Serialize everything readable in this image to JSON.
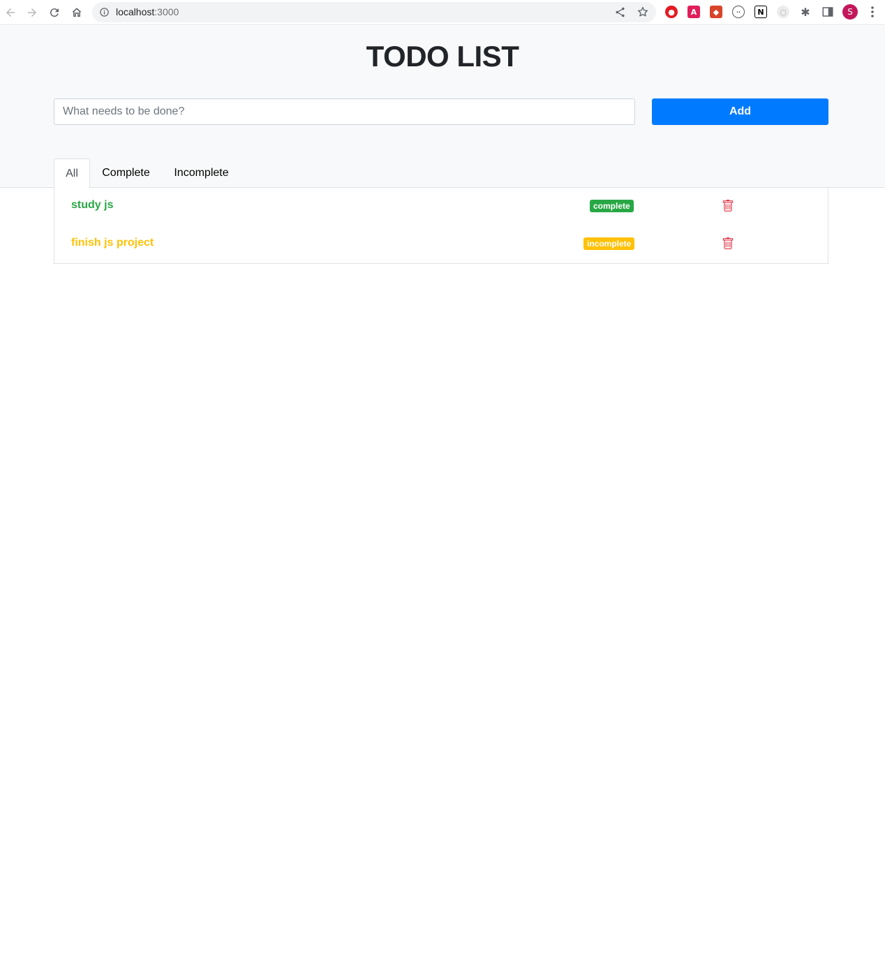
{
  "browser": {
    "url_host": "localhost",
    "url_port": ":3000",
    "avatar_letter": "S"
  },
  "app": {
    "title": "TODO LIST",
    "input_placeholder": "What needs to be done?",
    "input_value": "",
    "add_label": "Add"
  },
  "tabs": [
    {
      "label": "All",
      "active": true
    },
    {
      "label": "Complete",
      "active": false
    },
    {
      "label": "Incomplete",
      "active": false
    }
  ],
  "todos": [
    {
      "text": "study js",
      "status": "complete",
      "color": "#28a745"
    },
    {
      "text": "finish js project",
      "status": "incomplete",
      "color": "#ffc107"
    }
  ],
  "colors": {
    "primary": "#007bff",
    "success": "#28a745",
    "warning": "#ffc107",
    "danger": "#dc3545"
  }
}
